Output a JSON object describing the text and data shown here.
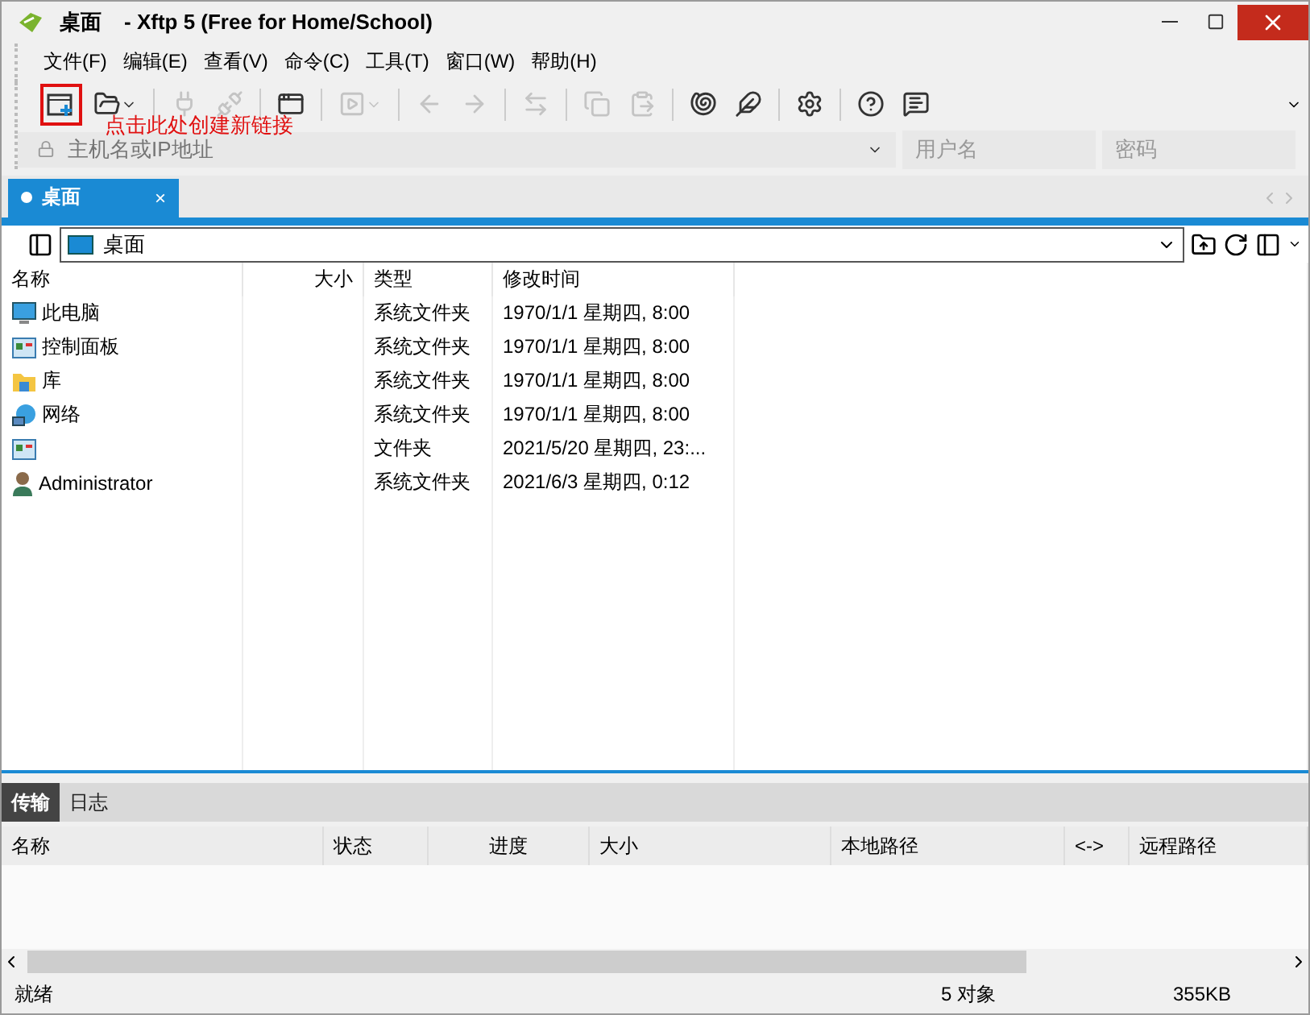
{
  "window": {
    "title": "桌面",
    "subtitle": "- Xftp 5 (Free for Home/School)"
  },
  "menu": [
    "文件(F)",
    "编辑(E)",
    "查看(V)",
    "命令(C)",
    "工具(T)",
    "窗口(W)",
    "帮助(H)"
  ],
  "toolbar": [
    {
      "kind": "new-session",
      "disabled": false,
      "highlighted": true
    },
    {
      "kind": "open",
      "disabled": false
    },
    {
      "kind": "separator"
    },
    {
      "kind": "connect",
      "disabled": true
    },
    {
      "kind": "disconnect",
      "disabled": true
    },
    {
      "kind": "separator"
    },
    {
      "kind": "properties",
      "disabled": false
    },
    {
      "kind": "separator"
    },
    {
      "kind": "play",
      "disabled": true
    },
    {
      "kind": "separator"
    },
    {
      "kind": "back",
      "disabled": true
    },
    {
      "kind": "forward",
      "disabled": true
    },
    {
      "kind": "separator"
    },
    {
      "kind": "swap",
      "disabled": true
    },
    {
      "kind": "separator"
    },
    {
      "kind": "copy",
      "disabled": true
    },
    {
      "kind": "paste",
      "disabled": true
    },
    {
      "kind": "separator"
    },
    {
      "kind": "shell",
      "disabled": false
    },
    {
      "kind": "feather",
      "disabled": false
    },
    {
      "kind": "separator"
    },
    {
      "kind": "settings",
      "disabled": false
    },
    {
      "kind": "separator"
    },
    {
      "kind": "help",
      "disabled": false
    },
    {
      "kind": "chat",
      "disabled": false
    }
  ],
  "annotation": "点击此处创建新链接",
  "address_bar": {
    "host_placeholder": "主机名或IP地址",
    "user_placeholder": "用户名",
    "password_placeholder": "密码"
  },
  "tabs": [
    {
      "label": "桌面",
      "selected": true,
      "close": "×"
    }
  ],
  "path": "桌面",
  "file_table": {
    "columns": [
      "名称",
      "大小",
      "类型",
      "修改时间"
    ],
    "rows": [
      {
        "kind": "computer",
        "name": "此电脑",
        "type": "系统文件夹",
        "modified": "1970/1/1 星期四, 8:00"
      },
      {
        "kind": "control-panel",
        "name": "控制面板",
        "type": "系统文件夹",
        "modified": "1970/1/1 星期四, 8:00"
      },
      {
        "kind": "library",
        "name": "库",
        "type": "系统文件夹",
        "modified": "1970/1/1 星期四, 8:00"
      },
      {
        "kind": "network",
        "name": "网络",
        "type": "系统文件夹",
        "modified": "1970/1/1 星期四, 8:00"
      },
      {
        "kind": "control-panel",
        "type": "文件夹",
        "modified": "2021/5/20 星期四, 23:..."
      },
      {
        "kind": "user",
        "name": "Administrator",
        "type": "系统文件夹",
        "modified": "2021/6/3 星期四, 0:12"
      }
    ]
  },
  "transfer_tabs": [
    {
      "label": "传输",
      "selected": true
    },
    {
      "label": "日志",
      "selected": false
    }
  ],
  "transfer_columns": [
    "名称",
    "状态",
    "进度",
    "大小",
    "本地路径",
    "<->",
    "远程路径"
  ],
  "status_bar": {
    "state": "就绪",
    "count": "5 对象",
    "size": "355KB"
  }
}
